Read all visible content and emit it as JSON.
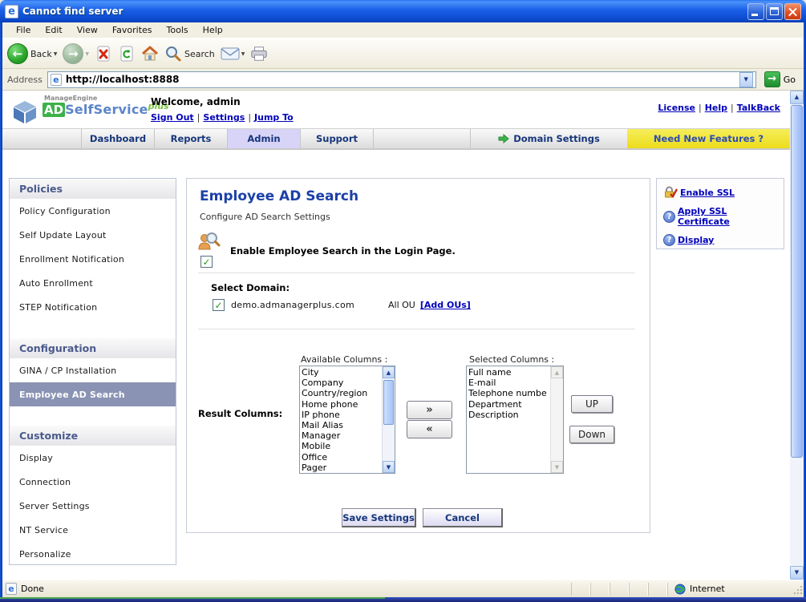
{
  "window": {
    "title": "Cannot find server"
  },
  "menu": {
    "items": [
      "File",
      "Edit",
      "View",
      "Favorites",
      "Tools",
      "Help"
    ]
  },
  "toolbar": {
    "back": "Back",
    "search": "Search"
  },
  "address": {
    "label": "Address",
    "url": "http://localhost:8888",
    "go": "Go"
  },
  "header": {
    "brand": "ManageEngine",
    "product_ad": "AD",
    "product_name": "SelfService",
    "product_plus": "plus",
    "welcome": "Welcome, admin",
    "sep": "|",
    "links": [
      "Sign Out",
      "Settings",
      "Jump To"
    ],
    "top_links": [
      "License",
      "Help",
      "TalkBack"
    ]
  },
  "nav": {
    "tabs": [
      "Dashboard",
      "Reports",
      "Admin",
      "Support"
    ],
    "active_tab": "Admin",
    "domain_settings": "Domain Settings",
    "need_features": "Need New Features ?"
  },
  "sidebar": {
    "sections": [
      {
        "title": "Policies",
        "items": [
          "Policy Configuration",
          "Self Update Layout",
          "Enrollment Notification",
          "Auto Enrollment",
          "STEP Notification"
        ]
      },
      {
        "title": "Configuration",
        "items": [
          "GINA / CP Installation",
          "Employee AD Search"
        ]
      },
      {
        "title": "Customize",
        "items": [
          "Display",
          "Connection",
          "Server Settings",
          "NT Service",
          "Personalize"
        ]
      }
    ],
    "selected_item": "Employee AD Search"
  },
  "main": {
    "title": "Employee AD Search",
    "subtitle": "Configure AD Search Settings",
    "enable_label": "Enable Employee Search in the Login Page.",
    "enable_checked": true,
    "check_glyph": "✓",
    "select_domain_label": "Select Domain:",
    "domain": {
      "name": "demo.admanagerplus.com",
      "checked": true,
      "ou_label": "All OU",
      "add_ous_link": "[Add OUs]"
    },
    "result_columns": {
      "label": "Result Columns:",
      "available_label": "Available Columns :",
      "selected_label": "Selected Columns :",
      "available": [
        "City",
        "Company",
        "Country/region",
        "Home phone",
        "IP phone",
        "Mail Alias",
        "Manager",
        "Mobile",
        "Office",
        "Pager"
      ],
      "selected": [
        "Full name",
        "E-mail",
        "Telephone numbe",
        "Department",
        "Description"
      ],
      "move_right": "»",
      "move_left": "«",
      "up_label": "UP",
      "down_label": "Down"
    },
    "actions": {
      "save": "Save Settings",
      "cancel": "Cancel"
    }
  },
  "quick_links": {
    "items": [
      {
        "label": "Enable SSL",
        "icon": "lock-check-icon"
      },
      {
        "label": "Apply SSL Certificate",
        "icon": "question-icon",
        "glyph": "?"
      },
      {
        "label": "Display",
        "icon": "question-icon",
        "glyph": "?"
      }
    ]
  },
  "status": {
    "done": "Done",
    "zone": "Internet"
  },
  "colors": {
    "titlebar_blue": "#1a5fe8",
    "active_tab_bg": "#d8d4f8",
    "highlight_yellow": "#eedd2a",
    "link_blue": "#0000bb",
    "nav_text_blue": "#16367c",
    "selected_item_bg": "#8a93b3",
    "section_title_blue": "#4a5a8c",
    "main_title_blue": "#1c40a8",
    "accent_green": "#2fa348"
  }
}
